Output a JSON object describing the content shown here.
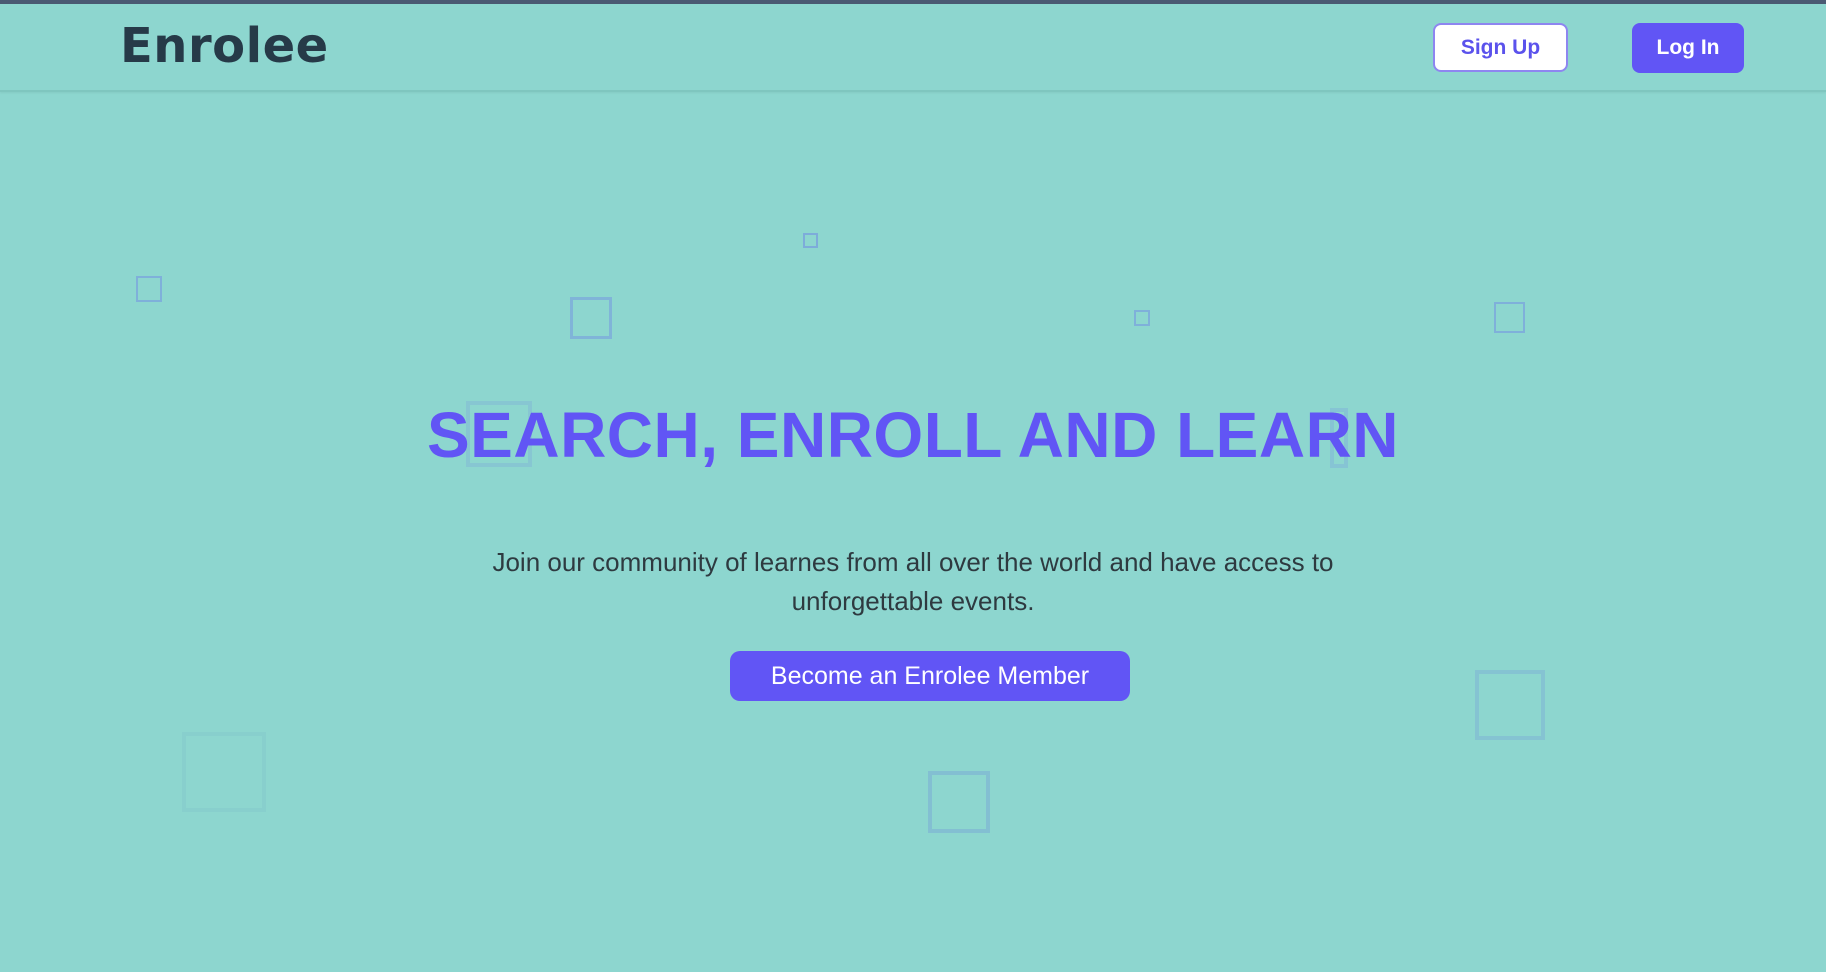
{
  "navbar": {
    "brand": "Enrolee",
    "signup_label": "Sign Up",
    "login_label": "Log In"
  },
  "hero": {
    "title": "SEARCH, ENROLL AND LEARN",
    "subtitle": "Join our community of learnes from all over the world and have access to unforgettable events.",
    "cta_label": "Become an Enrolee Member"
  },
  "colors": {
    "background": "#8dd6cf",
    "accent": "#6155f5",
    "brand_text": "#263a48",
    "body_text": "#2e3a40",
    "top_strip": "#4a5a73"
  }
}
